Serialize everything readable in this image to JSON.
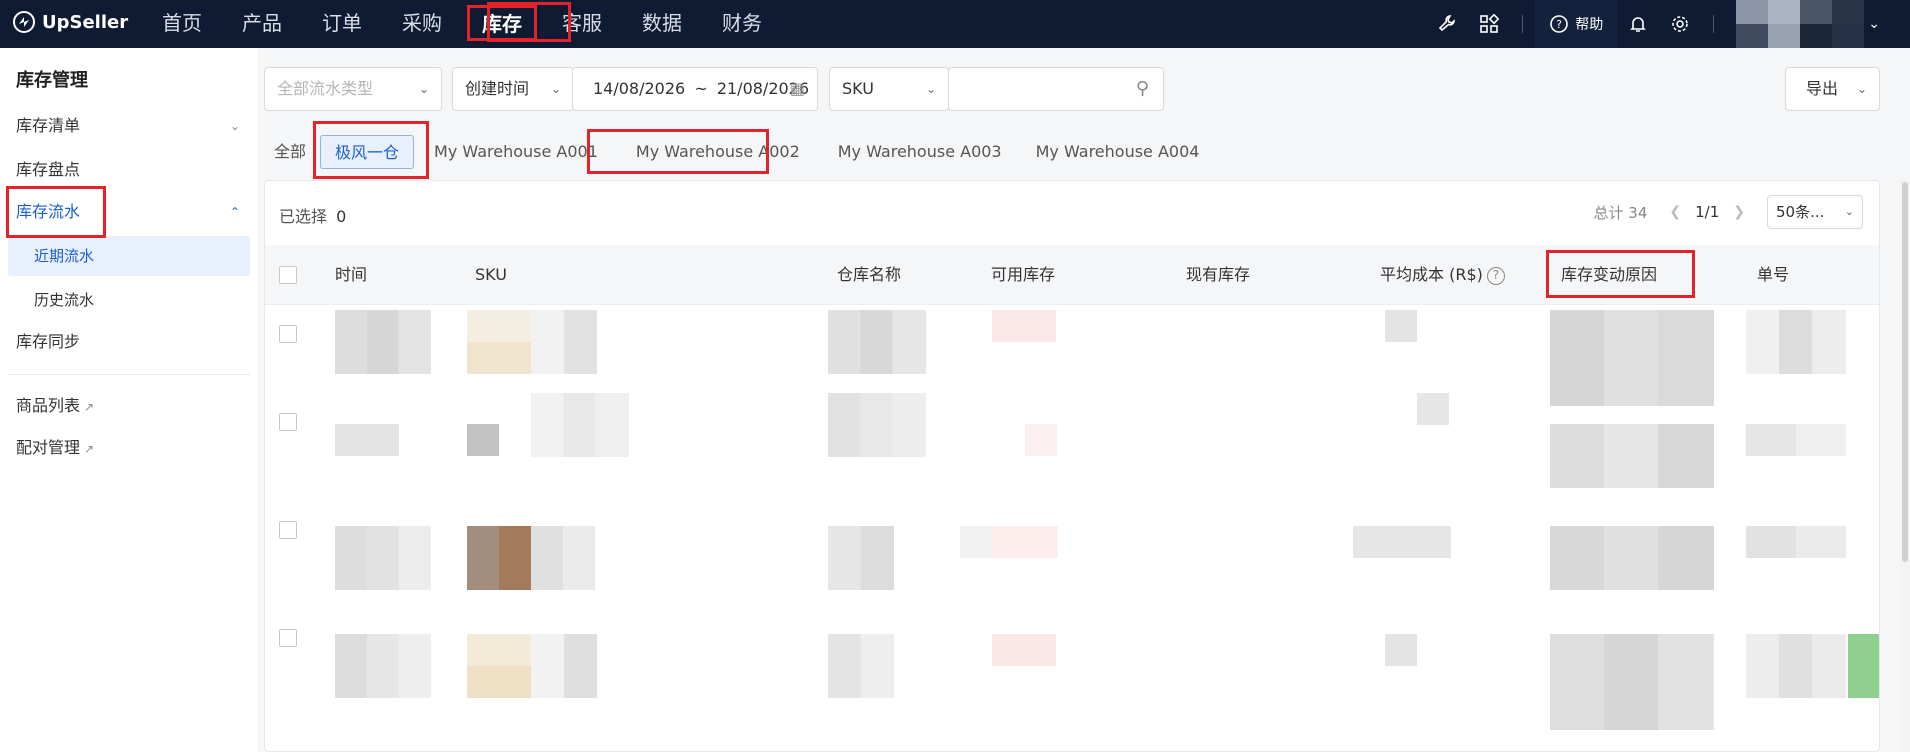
{
  "app": {
    "logo_text": "UpSeller"
  },
  "nav": {
    "items": [
      "首页",
      "产品",
      "订单",
      "采购",
      "库存",
      "客服",
      "数据",
      "财务"
    ],
    "active": "库存",
    "help_label": "帮助"
  },
  "sidebar": {
    "title": "库存管理",
    "items": {
      "inventory_list": "库存清单",
      "stocktake": "库存盘点",
      "flow": "库存流水",
      "recent_flow": "近期流水",
      "history_flow": "历史流水",
      "sync": "库存同步",
      "product_list": "商品列表",
      "pairing": "配对管理"
    }
  },
  "filters": {
    "flow_type_placeholder": "全部流水类型",
    "time_type": "创建时间",
    "date_start": "14/08/2026",
    "date_sep": "~",
    "date_end": "21/08/2026",
    "search_field": "SKU",
    "search_value": "",
    "export_label": "导出"
  },
  "tabs": [
    "全部",
    "极风一仓",
    "My Warehouse A001",
    "My Warehouse A002",
    "My Warehouse A003",
    "My Warehouse A004"
  ],
  "active_tab": "极风一仓",
  "table": {
    "selected_label": "已选择",
    "selected_count": "0",
    "total_label": "总计 34",
    "page": "1/1",
    "page_size": "50条...",
    "columns": [
      "时间",
      "SKU",
      "仓库名称",
      "可用库存",
      "现有库存",
      "平均成本 (R$)",
      "库存变动原因",
      "单号"
    ]
  },
  "colors": {
    "topbar": "#0e1b33",
    "accent": "#1a5fd0",
    "highlight": "#e3222a"
  }
}
